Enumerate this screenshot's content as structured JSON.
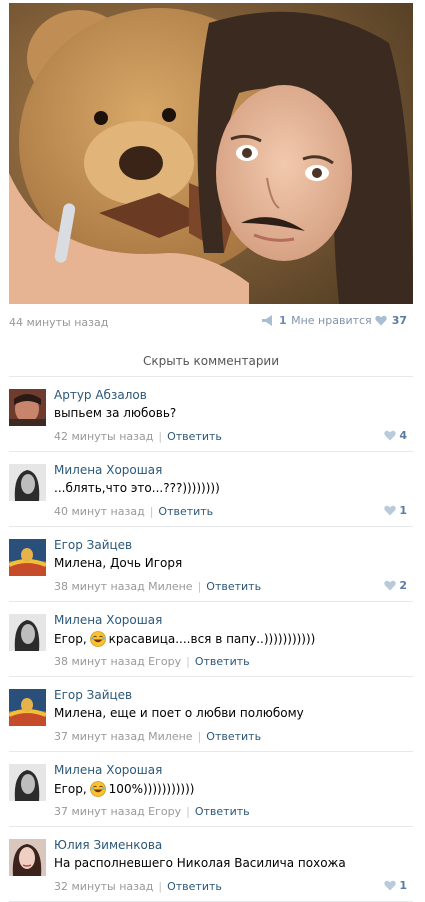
{
  "post": {
    "time": "44 минуты назад",
    "shares": "1",
    "like_label": "Мне нравится",
    "likes": "37"
  },
  "hide_comments_label": "Скрыть комментарии",
  "comments": [
    {
      "author": "Артур Абзалов",
      "text": "выпьем за любовь?",
      "time": "42 минуты назад",
      "reply": "Ответить",
      "likes": "4"
    },
    {
      "author": "Милена Хорошая",
      "text": "...блять,что это...???))))))))",
      "time": "40 минут назад",
      "reply": "Ответить",
      "likes": "1"
    },
    {
      "author": "Егор Зайцев",
      "text": "Милена, Дочь Игоря",
      "time": "38 минут назад Милене",
      "reply": "Ответить",
      "likes": "2"
    },
    {
      "author": "Милена Хорошая",
      "text_before": "Егор,",
      "text_after": "красавица....вся в папу..)))))))))))",
      "time": "38 минут назад Егору",
      "reply": "Ответить",
      "likes": ""
    },
    {
      "author": "Егор Зайцев",
      "text": "Милена, еще и поет о любви полюбому",
      "time": "37 минут назад Милене",
      "reply": "Ответить",
      "likes": ""
    },
    {
      "author": "Милена Хорошая",
      "text_before": "Егор,",
      "text_after": "100%)))))))))))",
      "time": "37 минут назад Егору",
      "reply": "Ответить",
      "likes": ""
    },
    {
      "author": "Юлия Зименкова",
      "text": "На располневшего Николая Василича похожа",
      "time": "32 минуты назад",
      "reply": "Ответить",
      "likes": "1"
    }
  ],
  "colors": {
    "link": "#2b587a",
    "meta": "#999999",
    "like": "#587ca3"
  },
  "icons": {
    "share": "megaphone-icon",
    "like": "heart-icon",
    "emoji": "laughing-emoji-icon"
  }
}
